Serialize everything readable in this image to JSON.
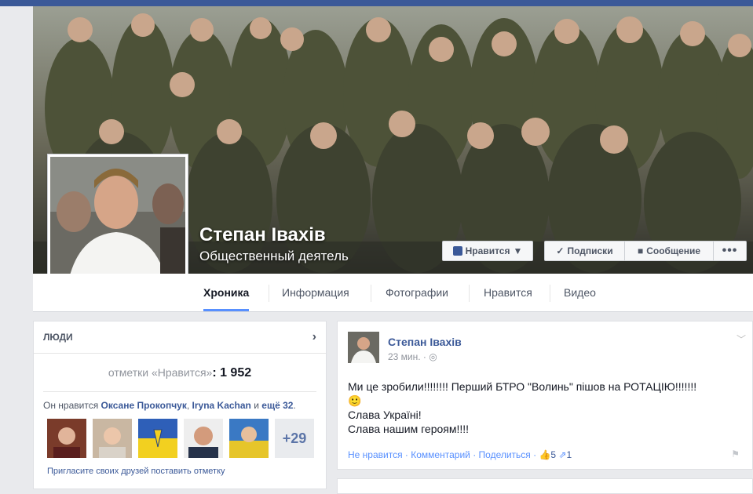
{
  "profile": {
    "name": "Степан Івахів",
    "category": "Общественный деятель"
  },
  "actions": {
    "like": "Нравится",
    "subscriptions": "Подписки",
    "message": "Сообщение",
    "more": "•••"
  },
  "tabs": [
    "Хроника",
    "Информация",
    "Фотографии",
    "Нравится",
    "Видео"
  ],
  "people_panel": {
    "title": "ЛЮДИ",
    "likes_label": "отметки «Нравится»",
    "likes_count": ": 1 952",
    "liked_by_prefix": "Он нравится ",
    "liked_by_1": "Оксане Прокопчук",
    "liked_by_sep": ", ",
    "liked_by_2": "Iryna Kachan",
    "liked_by_and": " и ",
    "liked_by_more": "ещё 32",
    "liked_by_end": ".",
    "more_count": "+29",
    "invite_text": "Пригласите своих друзей поставить отметку"
  },
  "post": {
    "author": "Степан Івахів",
    "time": "23 мин. · ",
    "line1": "Ми це зробили!!!!!!!! Перший БТРО \"Волинь\" пішов на РОТАЦІЮ!!!!!!!",
    "emoji": "🙂",
    "line2": "Слава Україні!",
    "line3": "Слава нашим героям!!!!",
    "unlike": "Не нравится",
    "comment": "Комментарий",
    "share": "Поделиться",
    "sep": " · ",
    "like_count": "5",
    "share_count": "1"
  },
  "colors": {
    "brand": "#3b5998",
    "tab_accent": "#5890ff",
    "page_bg": "#e9eaed"
  }
}
